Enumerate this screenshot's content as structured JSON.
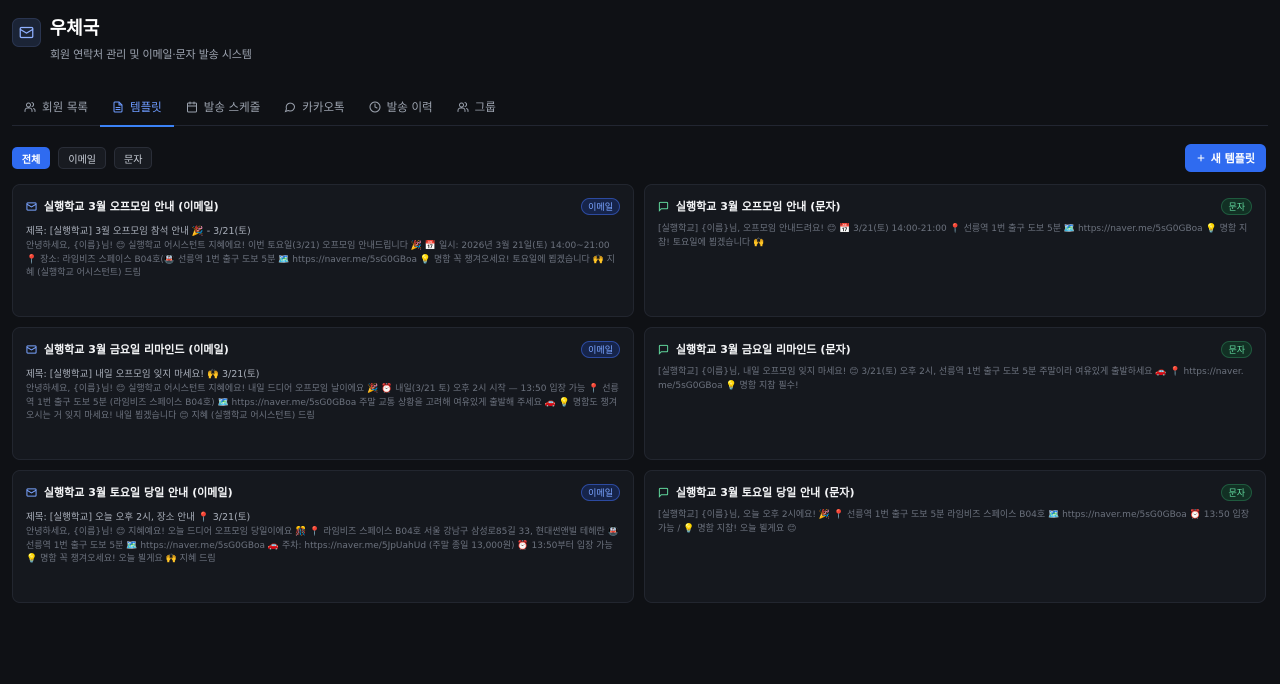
{
  "app": {
    "title": "우체국",
    "subtitle": "회원 연락처 관리 및 이메일·문자 발송 시스템"
  },
  "tabs": [
    {
      "label": "회원 목록",
      "icon": "users-icon",
      "active": false
    },
    {
      "label": "템플릿",
      "icon": "file-text-icon",
      "active": true
    },
    {
      "label": "발송 스케줄",
      "icon": "calendar-icon",
      "active": false
    },
    {
      "label": "카카오톡",
      "icon": "message-circle-icon",
      "active": false
    },
    {
      "label": "발송 이력",
      "icon": "clock-icon",
      "active": false
    },
    {
      "label": "그룹",
      "icon": "users-group-icon",
      "active": false
    }
  ],
  "filters": [
    {
      "label": "전체",
      "active": true
    },
    {
      "label": "이메일",
      "active": false
    },
    {
      "label": "문자",
      "active": false
    }
  ],
  "new_button": {
    "label": "새 템플릿",
    "icon": "plus-icon"
  },
  "colors": {
    "accent": "#2f6bf0",
    "email_badge": "#79a3ff",
    "sms_badge": "#5fd49a",
    "background": "#0f1115"
  },
  "templates": [
    {
      "type": "email",
      "badge": "이메일",
      "title": "실행학교 3월 오프모임 안내 (이메일)",
      "subject": "제목: [실행학교] 3월 오프모임 참석 안내 🎉 - 3/21(토)",
      "body": "안녕하세요, {이름}님! 😊 실행학교 어시스턴트 지혜에요! 이번 토요일(3/21) 오프모임 안내드립니다 🎉 📅 일시: 2026년 3월 21일(토) 14:00~21:00 📍 장소: 라임비즈 스페이스 B04호(🚇 선릉역 1번 출구 도보 5분 🗺️ https://naver.me/5sG0GBoa 💡 명함 꼭 챙겨오세요! 토요일에 뵙겠습니다 🙌 지혜 (실행학교 어시스턴트) 드림"
    },
    {
      "type": "sms",
      "badge": "문자",
      "title": "실행학교 3월 오프모임 안내 (문자)",
      "subject": "",
      "body": "[실행학교] {이름}님, 오프모임 안내드려요! 😊 📅 3/21(토) 14:00-21:00 📍 선릉역 1번 출구 도보 5분 🗺️ https://naver.me/5sG0GBoa 💡 명함 지참! 토요일에 뵙겠습니다 🙌"
    },
    {
      "type": "email",
      "badge": "이메일",
      "title": "실행학교 3월 금요일 리마인드 (이메일)",
      "subject": "제목: [실행학교] 내일 오프모임 잊지 마세요! 🙌 3/21(토)",
      "body": "안녕하세요, {이름}님! 😊 실행학교 어시스턴트 지혜에요! 내일 드디어 오프모임 날이에요 🎉 ⏰ 내일(3/21 토) 오후 2시 시작 — 13:50 입장 가능 📍 선릉역 1번 출구 도보 5분 (라임비즈 스페이스 B04호) 🗺️ https://naver.me/5sG0GBoa 주말 교통 상황을 고려해 여유있게 출발해 주세요 🚗 💡 명함도 챙겨오시는 거 잊지 마세요! 내일 뵙겠습니다 😊 지혜 (실행학교 어시스턴트) 드림"
    },
    {
      "type": "sms",
      "badge": "문자",
      "title": "실행학교 3월 금요일 리마인드 (문자)",
      "subject": "",
      "body": "[실행학교] {이름}님, 내일 오프모임 잊지 마세요! 😊 3/21(토) 오후 2시, 선릉역 1번 출구 도보 5분 주말이라 여유있게 출발하세요 🚗 📍 https://naver.me/5sG0GBoa 💡 명함 지참 필수!"
    },
    {
      "type": "email",
      "badge": "이메일",
      "title": "실행학교 3월 토요일 당일 안내 (이메일)",
      "subject": "제목: [실행학교] 오늘 오후 2시, 장소 안내 📍 3/21(토)",
      "body": "안녕하세요, {이름}님! 😊 지혜예요! 오늘 드디어 오프모임 당일이에요 🎊 📍 라임비즈 스페이스 B04호 서울 강남구 삼성로85길 33, 현대썬앤빌 테헤란 🚇 선릉역 1번 출구 도보 5분 🗺️ https://naver.me/5sG0GBoa 🚗 주차: https://naver.me/5JpUahUd (주말 종일 13,000원) ⏰ 13:50부터 입장 가능 💡 명함 꼭 챙겨오세요! 오늘 뵐게요 🙌 지혜 드림"
    },
    {
      "type": "sms",
      "badge": "문자",
      "title": "실행학교 3월 토요일 당일 안내 (문자)",
      "subject": "",
      "body": "[실행학교] {이름}님, 오늘 오후 2시에요! 🎉 📍 선릉역 1번 출구 도보 5분 라임비즈 스페이스 B04호 🗺️ https://naver.me/5sG0GBoa ⏰ 13:50 입장가능 / 💡 명함 지참! 오늘 뵐게요 😊"
    }
  ]
}
